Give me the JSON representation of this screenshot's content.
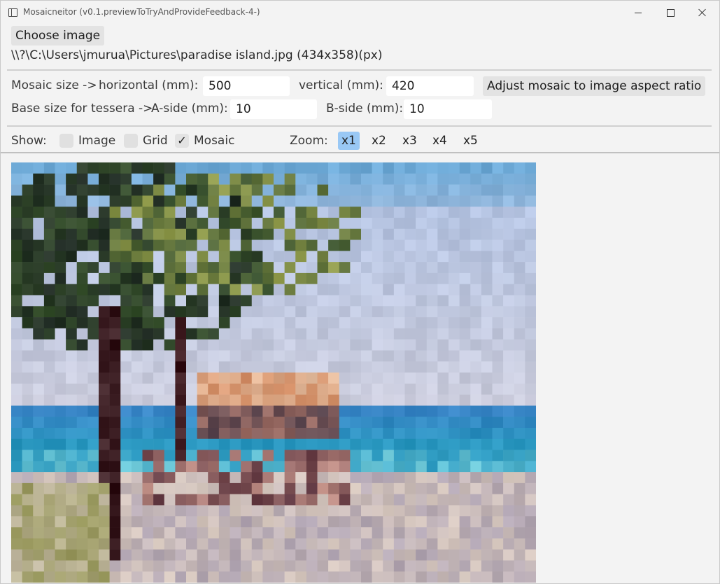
{
  "window": {
    "title": "Mosaicneitor (v0.1.previewToTryAndProvideFeedback-4-)"
  },
  "toolbar": {
    "choose_image_label": "Choose image",
    "image_path": "\\\\?\\C:\\Users\\jmurua\\Pictures\\paradise island.jpg (434x358)(px)"
  },
  "mosaic_size": {
    "label": "Mosaic size ->",
    "horizontal_label": "horizontal (mm):",
    "horizontal_value": "500",
    "vertical_label": "vertical (mm):",
    "vertical_value": "420",
    "adjust_label": "Adjust mosaic to image aspect ratio"
  },
  "tessera": {
    "label": "Base size for tessera ->",
    "a_side_label": "A-side (mm):",
    "a_side_value": "10",
    "b_side_label": "B-side (mm):",
    "b_side_value": "10"
  },
  "show": {
    "label": "Show:",
    "image_label": "Image",
    "image_checked": false,
    "grid_label": "Grid",
    "grid_checked": false,
    "mosaic_label": "Mosaic",
    "mosaic_checked": true,
    "check_glyph": "✓"
  },
  "zoom": {
    "label": "Zoom:",
    "options": [
      "x1",
      "x2",
      "x3",
      "x4",
      "x5"
    ],
    "selected": "x1"
  },
  "colors": {
    "accent": "#99c8f5",
    "background": "#f3f3f3"
  },
  "icons": {
    "app": "app-window-icon",
    "minimize": "minimize-icon",
    "maximize": "maximize-icon",
    "close": "close-icon"
  }
}
